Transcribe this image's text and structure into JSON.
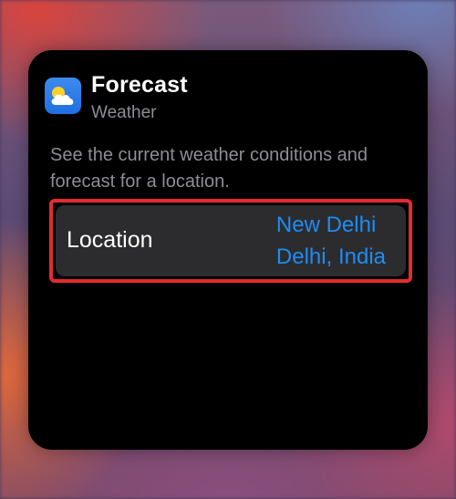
{
  "widget": {
    "title": "Forecast",
    "app_name": "Weather",
    "description": "See the current weather conditions and forecast for a location.",
    "app_icon": "weather-cloud-sun-icon"
  },
  "location": {
    "label": "Location",
    "city": "New Delhi",
    "region": "Delhi, India"
  },
  "colors": {
    "accent": "#1e8cf5",
    "highlight": "#e32b2f",
    "card_background": "#000000",
    "row_background": "#2c2c2e",
    "secondary_text": "#8e8e93"
  }
}
